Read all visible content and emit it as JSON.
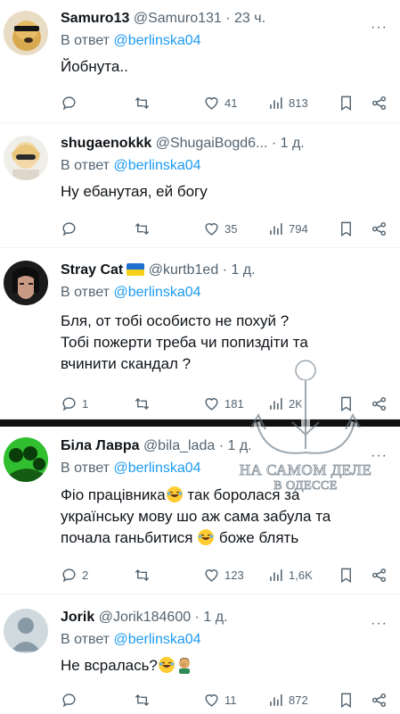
{
  "reply_prefix": "В ответ",
  "tweets": [
    {
      "name": "Samuro13",
      "handle": "@Samuro131",
      "dot": "·",
      "time": "23 ч.",
      "reply_to": "@berlinska04",
      "text": "Йобнута..",
      "replies": "",
      "retweets": "",
      "likes": "41",
      "views": "813"
    },
    {
      "name": "shugaenokkk",
      "handle": "@ShugaiBogd6...",
      "dot": "·",
      "time": "1 д.",
      "reply_to": "@berlinska04",
      "text": "Ну ебанутая, ей богу",
      "replies": "",
      "retweets": "",
      "likes": "35",
      "views": "794"
    },
    {
      "name": "Stray Cat",
      "handle": "@kurtb1ed",
      "dot": "·",
      "time": "1 д.",
      "reply_to": "@berlinska04",
      "text_lines": [
        "Бля, от тобі особисто не похуй ?",
        "Тобі пожерти треба чи попиздіти та",
        "вчинити скандал ?"
      ],
      "replies": "1",
      "retweets": "",
      "likes": "181",
      "views": "2K"
    },
    {
      "name": "Біла Лавра",
      "handle": "@bila_lada",
      "dot": "·",
      "time": "1 д.",
      "reply_to": "@berlinska04",
      "text_a": "Фіо працівника",
      "text_b": " так боролася за",
      "text_c": "українську мову шо аж сама забула та",
      "text_d": "почала ганьбитися ",
      "text_e": " боже блять",
      "replies": "2",
      "retweets": "",
      "likes": "123",
      "views": "1,6K"
    },
    {
      "name": "Jorik",
      "handle": "@Jorik184600",
      "dot": "·",
      "time": "1 д.",
      "reply_to": "@berlinska04",
      "text": "Не всралась?",
      "replies": "",
      "retweets": "",
      "likes": "11",
      "views": "872"
    }
  ],
  "watermark": {
    "line1": "НА САМОМ ДЕЛЕ",
    "line2": "В ОДЕССЕ"
  },
  "colors": {
    "link": "#1d9bf0",
    "secondary": "#536471",
    "text": "#0f1419"
  }
}
